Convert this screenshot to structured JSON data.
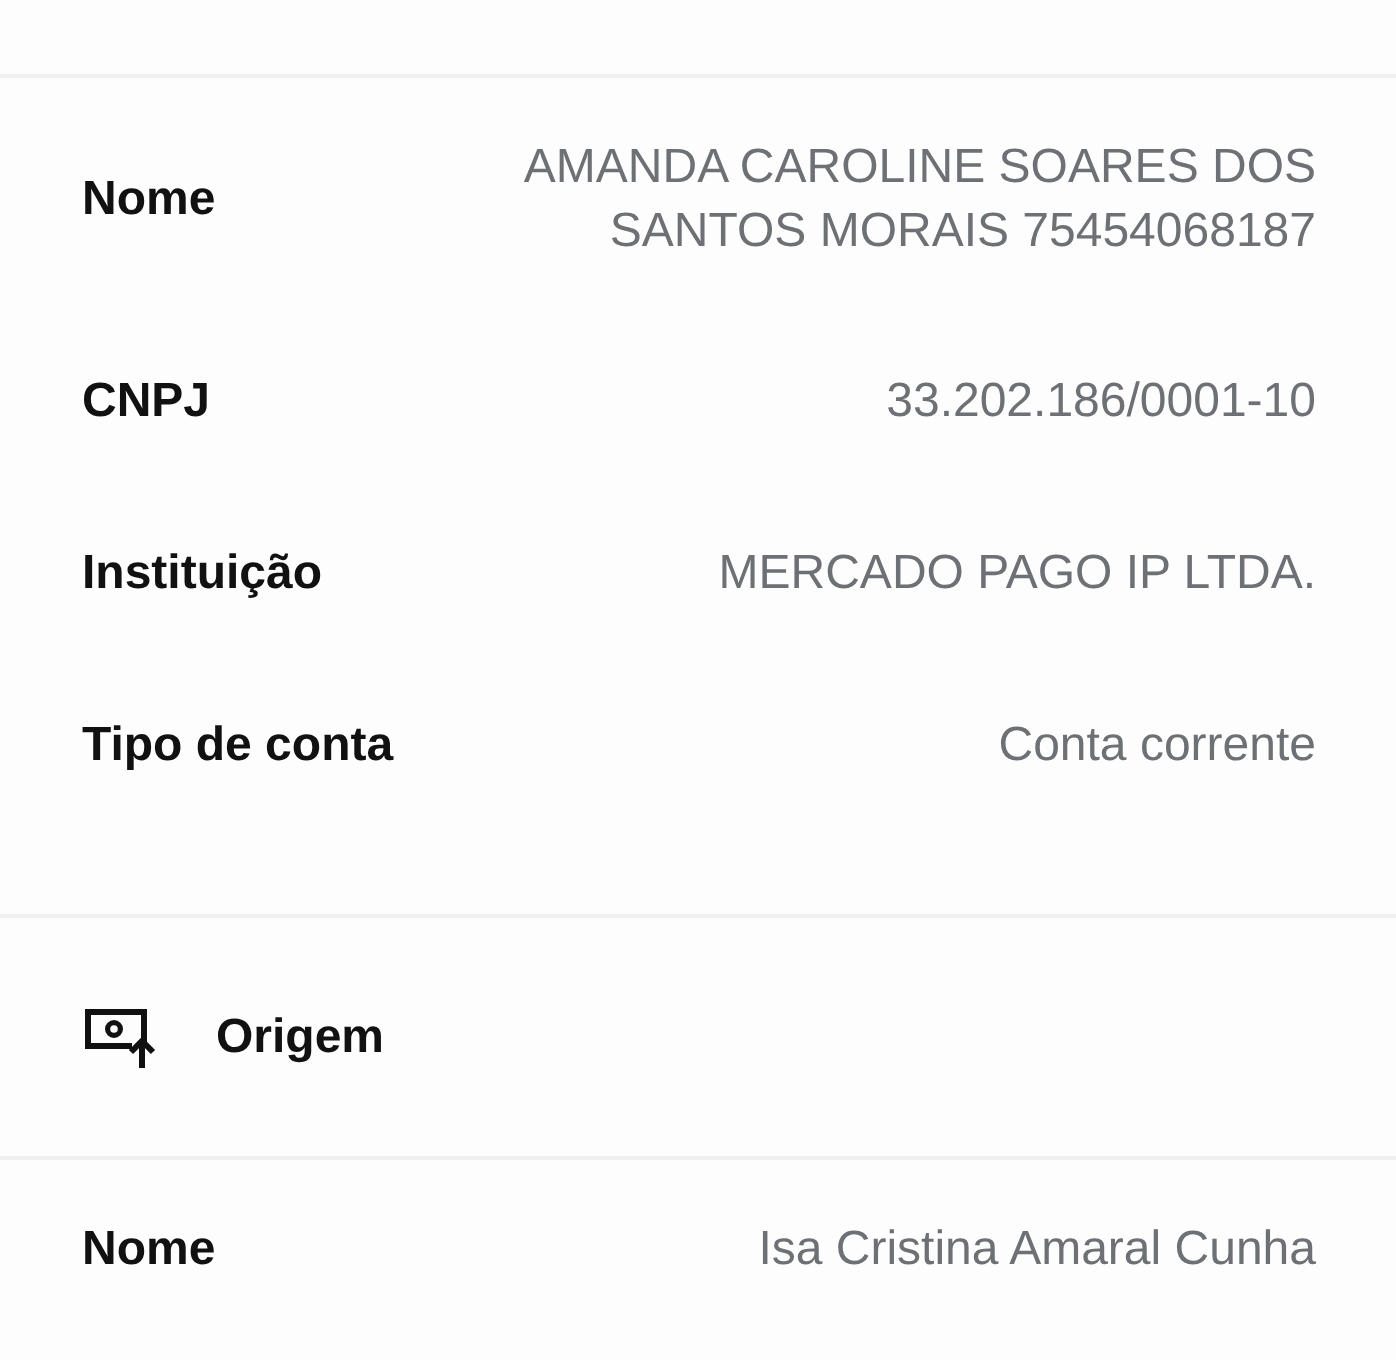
{
  "recipient": {
    "rows": [
      {
        "label": "Nome",
        "value": "AMANDA CAROLINE SOARES DOS SANTOS MORAIS 75454068187"
      },
      {
        "label": "CNPJ",
        "value": "33.202.186/0001-10"
      },
      {
        "label": "Instituição",
        "value": "MERCADO PAGO IP LTDA."
      },
      {
        "label": "Tipo de conta",
        "value": "Conta corrente"
      }
    ]
  },
  "origin": {
    "title": "Origem",
    "rows": [
      {
        "label": "Nome",
        "value": "Isa Cristina Amaral Cunha"
      }
    ]
  }
}
